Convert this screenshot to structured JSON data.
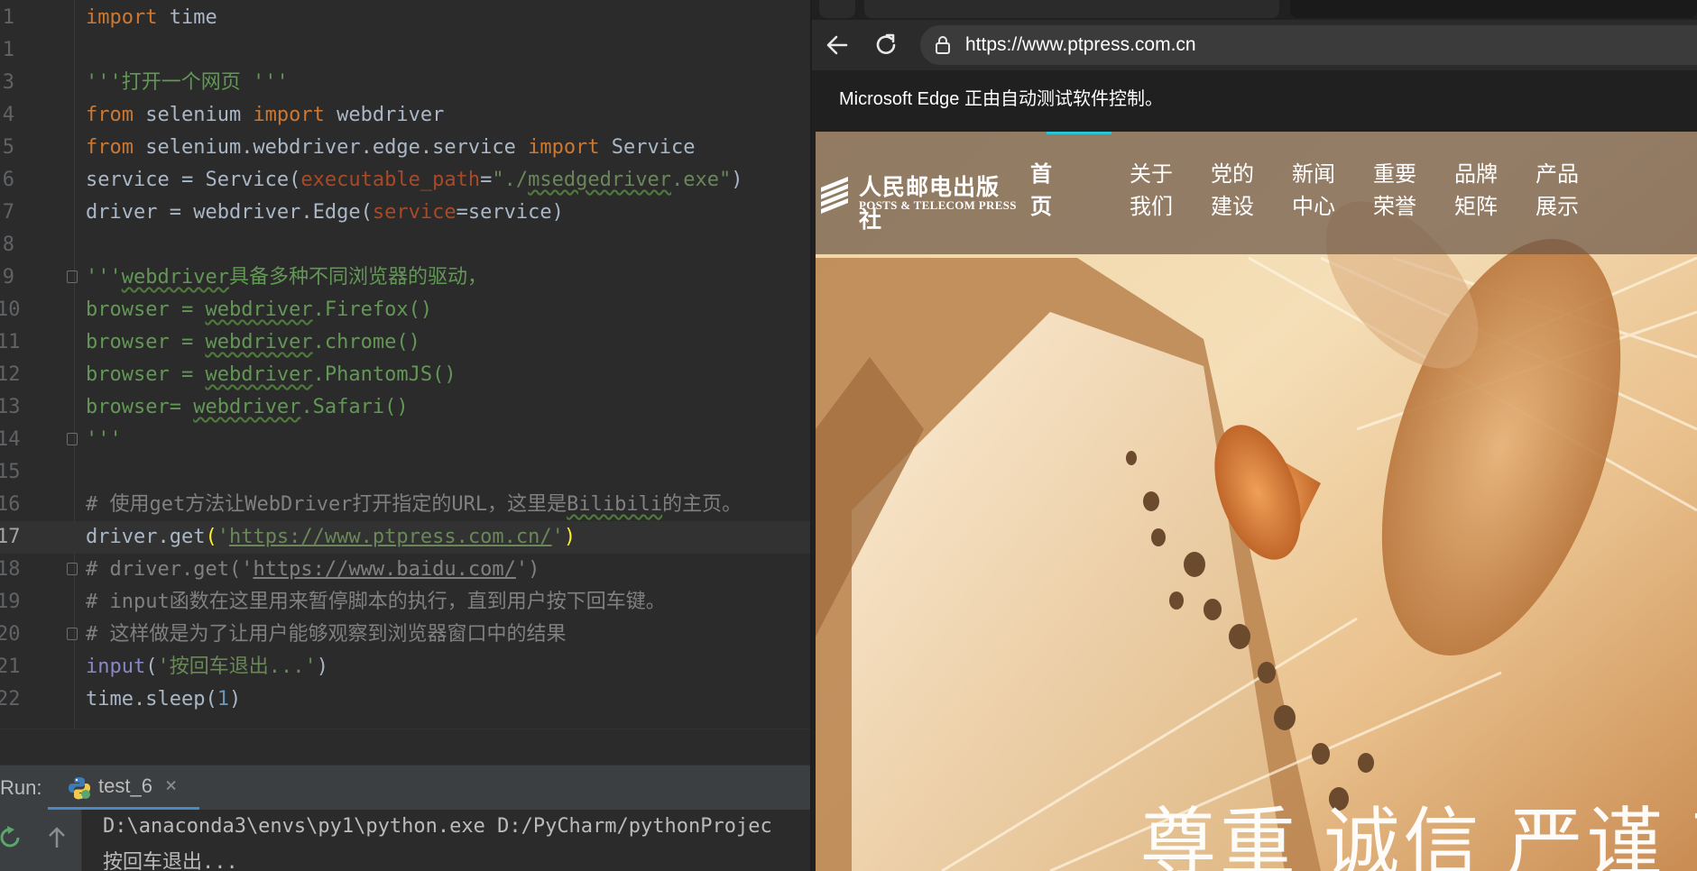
{
  "ide": {
    "code_lines": [
      {
        "n": "1",
        "parts": [
          [
            "kw",
            "import"
          ],
          [
            "plain",
            " time"
          ]
        ]
      },
      {
        "n": "1",
        "parts": []
      },
      {
        "n": "3",
        "parts": [
          [
            "doc",
            "'''打开一个网页 '''"
          ]
        ]
      },
      {
        "n": "4",
        "parts": [
          [
            "kw",
            "from"
          ],
          [
            "plain",
            " selenium "
          ],
          [
            "kw",
            "import"
          ],
          [
            "plain",
            " webdriver"
          ]
        ]
      },
      {
        "n": "5",
        "parts": [
          [
            "kw",
            "from"
          ],
          [
            "plain",
            " selenium.webdriver.edge.service "
          ],
          [
            "kw",
            "import"
          ],
          [
            "plain",
            " Service"
          ]
        ]
      },
      {
        "n": "6",
        "parts": [
          [
            "plain",
            "service = Service("
          ],
          [
            "param",
            "executable_path"
          ],
          [
            "plain",
            "="
          ],
          [
            "str",
            "\"./"
          ],
          [
            "strw",
            "msedgedriver"
          ],
          [
            "str",
            ".exe\""
          ],
          [
            "plain",
            ")"
          ]
        ]
      },
      {
        "n": "7",
        "parts": [
          [
            "plain",
            "driver = webdriver.Edge("
          ],
          [
            "param",
            "service"
          ],
          [
            "plain",
            "=service)"
          ]
        ]
      },
      {
        "n": "8",
        "parts": []
      },
      {
        "n": "9",
        "fold": true,
        "parts": [
          [
            "doc",
            "'''"
          ],
          [
            "docw",
            "webdriver"
          ],
          [
            "doc",
            "具备多种不同浏览器的驱动，"
          ]
        ]
      },
      {
        "n": "10",
        "parts": [
          [
            "doc",
            "browser = "
          ],
          [
            "docw",
            "webdriver"
          ],
          [
            "doc",
            ".Firefox()"
          ]
        ]
      },
      {
        "n": "11",
        "parts": [
          [
            "doc",
            "browser = "
          ],
          [
            "docw",
            "webdriver"
          ],
          [
            "doc",
            ".chrome()"
          ]
        ]
      },
      {
        "n": "12",
        "parts": [
          [
            "doc",
            "browser = "
          ],
          [
            "docw",
            "webdriver"
          ],
          [
            "doc",
            ".PhantomJS()"
          ]
        ]
      },
      {
        "n": "13",
        "parts": [
          [
            "doc",
            "browser= "
          ],
          [
            "docw",
            "webdriver"
          ],
          [
            "doc",
            ".Safari()"
          ]
        ]
      },
      {
        "n": "14",
        "fold": true,
        "parts": [
          [
            "doc",
            "'''"
          ]
        ]
      },
      {
        "n": "15",
        "parts": []
      },
      {
        "n": "16",
        "parts": [
          [
            "cmt",
            "# 使用get方法让WebDriver打开指定的URL，这里是"
          ],
          [
            "cmtw",
            "Bilibili"
          ],
          [
            "cmt",
            "的主页。"
          ]
        ]
      },
      {
        "n": "17",
        "current": true,
        "parts": [
          [
            "plain",
            "driver.get"
          ],
          [
            "hl",
            "("
          ],
          [
            "str",
            "'"
          ],
          [
            "strurl",
            "https://www.ptpress.com.cn/"
          ],
          [
            "str",
            "'"
          ],
          [
            "hl",
            ")"
          ]
        ]
      },
      {
        "n": "18",
        "fold": true,
        "parts": [
          [
            "cmt",
            "# driver.get('"
          ],
          [
            "cmturl",
            "https://www.baidu.com/"
          ],
          [
            "cmt",
            "')"
          ]
        ]
      },
      {
        "n": "19",
        "parts": [
          [
            "cmt",
            "# input函数在这里用来暂停脚本的执行，直到用户按下回车键。"
          ]
        ]
      },
      {
        "n": "20",
        "fold": true,
        "parts": [
          [
            "cmt",
            "# 这样做是为了让用户能够观察到浏览器窗口中的结果"
          ]
        ]
      },
      {
        "n": "21",
        "parts": [
          [
            "builtin",
            "input"
          ],
          [
            "plain",
            "("
          ],
          [
            "str",
            "'按回车退出...'"
          ],
          [
            "plain",
            ")"
          ]
        ]
      },
      {
        "n": "22",
        "parts": [
          [
            "plain",
            "time.sleep("
          ],
          [
            "num",
            "1"
          ],
          [
            "plain",
            ")"
          ]
        ]
      }
    ],
    "run_label": "Run:",
    "run_tab_name": "test_6",
    "run_tab_close": "×",
    "output_lines": [
      "D:\\anaconda3\\envs\\py1\\python.exe D:/PyCharm/pythonProjec",
      "按回车退出..."
    ]
  },
  "browser": {
    "url": "https://www.ptpress.com.cn",
    "infobar_message": "Microsoft Edge 正由自动测试软件控制。",
    "site": {
      "logo_cn": "人民邮电出版社",
      "logo_en": "POSTS & TELECOM PRESS",
      "nav": [
        {
          "line1": "首",
          "line2": "页",
          "active": true
        },
        {
          "line1": "关于",
          "line2": "我们"
        },
        {
          "line1": "党的",
          "line2": "建设"
        },
        {
          "line1": "新闻",
          "line2": "中心"
        },
        {
          "line1": "重要",
          "line2": "荣誉"
        },
        {
          "line1": "品牌",
          "line2": "矩阵"
        },
        {
          "line1": "产品",
          "line2": "展示"
        }
      ],
      "slogan": "尊重  诚信  严谨  高效"
    },
    "colors": {
      "accent": "#2bc4d4",
      "nav_overlay": "#6e5848"
    }
  }
}
